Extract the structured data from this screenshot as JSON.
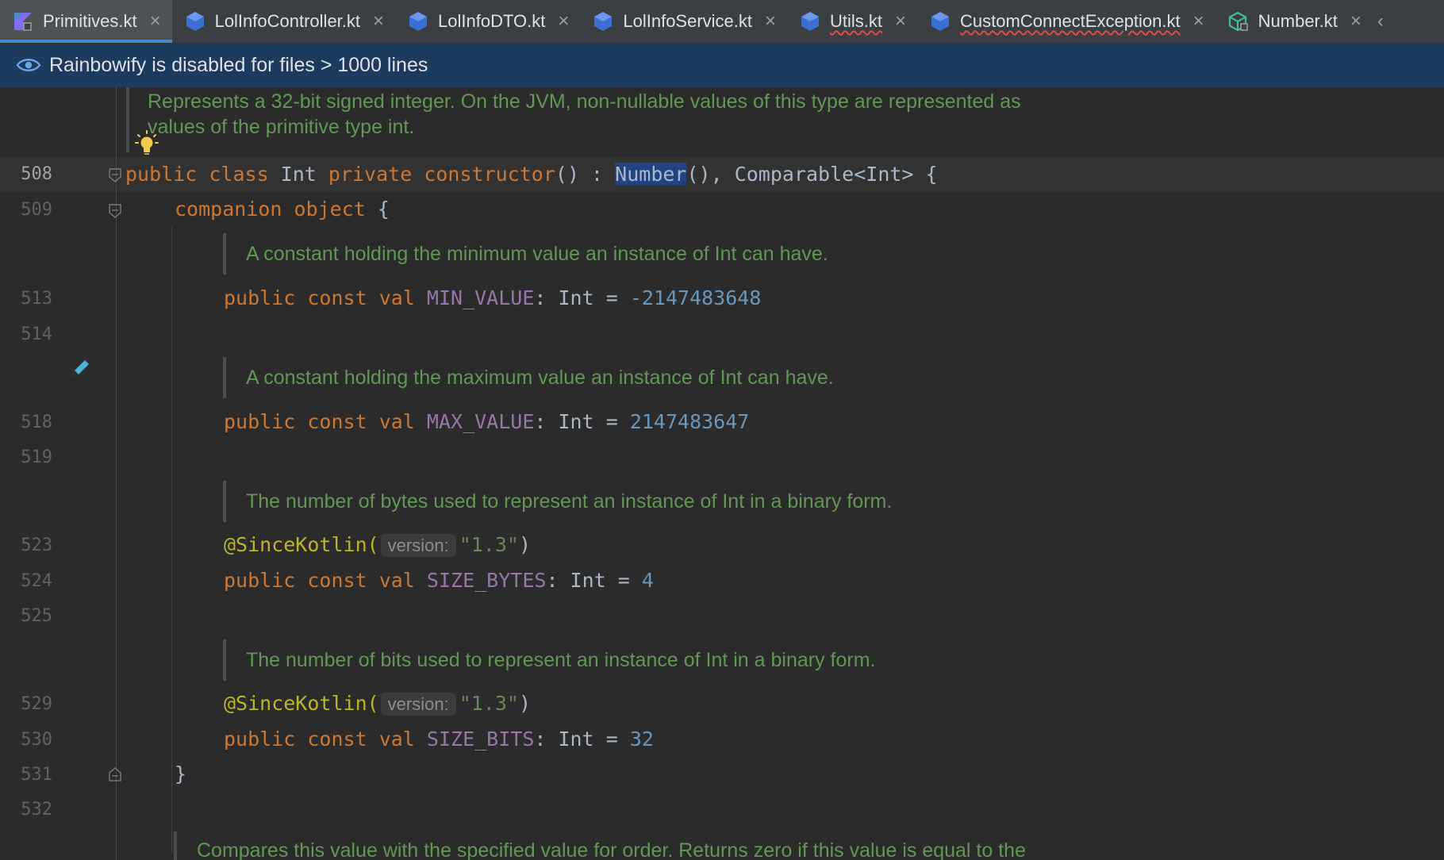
{
  "tabs": [
    {
      "label": "Primitives.kt",
      "active": true,
      "icon": "kotlin-file-icon"
    },
    {
      "label": "LolInfoController.kt",
      "icon": "class-icon"
    },
    {
      "label": "LolInfoDTO.kt",
      "icon": "class-icon"
    },
    {
      "label": "LolInfoService.kt",
      "icon": "class-icon"
    },
    {
      "label": "Utils.kt",
      "icon": "class-icon",
      "error": true
    },
    {
      "label": "CustomConnectException.kt",
      "icon": "class-icon",
      "error": true
    },
    {
      "label": "Number.kt",
      "icon": "abstract-class-icon"
    }
  ],
  "tab_close_glyph": "×",
  "banner": {
    "text": "Rainbowify is disabled for files > 1000 lines",
    "icon": "eye-icon"
  },
  "editor": {
    "doc_header": {
      "line1": "Represents a 32-bit signed integer. On the JVM, non-nullable values of this type are represented as",
      "line2": "values of the primitive type int."
    },
    "line_numbers": [
      "508",
      "509",
      "513",
      "514",
      "518",
      "519",
      "523",
      "524",
      "525",
      "529",
      "530",
      "531",
      "532"
    ],
    "docs": {
      "min": "A constant holding the minimum value an instance of Int can have.",
      "max": "A constant holding the maximum value an instance of Int can have.",
      "bytes": "The number of bytes used to represent an instance of Int in a binary form.",
      "bits": "The number of bits used to represent an instance of Int in a binary form.",
      "compare": "Compares this value with the specified value for order. Returns zero if this value is equal to the"
    },
    "code": {
      "l508": {
        "public": "public",
        "class": "class",
        "name": " Int ",
        "private": "private",
        "constructor": "constructor",
        "paren": "() : ",
        "number": "Number",
        "rest": "(), ",
        "comparable": "Comparable<Int> {"
      },
      "l509": {
        "companion": "companion",
        "object": "object",
        "brace": " {"
      },
      "const_prefix": {
        "public": "public",
        "const": "const",
        "val": "val"
      },
      "min": {
        "name": "MIN_VALUE",
        "type": ": Int = ",
        "value": "-2147483648"
      },
      "max": {
        "name": "MAX_VALUE",
        "type": ": Int = ",
        "value": "2147483647"
      },
      "bytes": {
        "name": "SIZE_BYTES",
        "type": ": Int = ",
        "value": "4"
      },
      "bits": {
        "name": "SIZE_BITS",
        "type": ": Int = ",
        "value": "32"
      },
      "annotation": {
        "name": "@SinceKotlin(",
        "hint": "version:",
        "value": "\"1.3\"",
        "close": ")"
      },
      "l531": "}"
    }
  },
  "colors": {
    "keyword": "#cc7832",
    "property": "#9876aa",
    "number": "#6897bb",
    "doc": "#629755",
    "annotation": "#bbb529",
    "string": "#6a8759",
    "banner_bg": "#1d3a5f",
    "tab_accent": "#4a88c7"
  }
}
